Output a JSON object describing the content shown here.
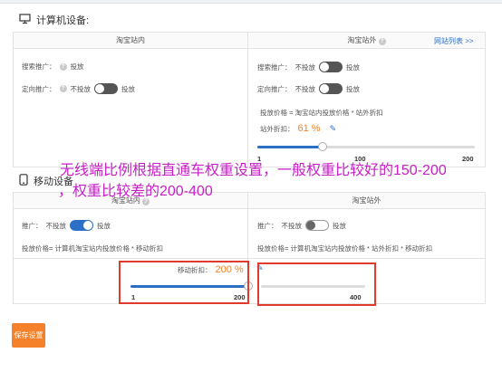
{
  "computer_section": {
    "title": "计算机设备:",
    "inner_header": "淘宝站内",
    "outer_header": "淘宝站外",
    "site_list_link": "网站列表 >>",
    "inner": {
      "search_promo_label": "搜索推广：",
      "search_promo_value": "投放",
      "targeted_promo_label": "定向推广：",
      "no_put": "不投放",
      "put": "投放"
    },
    "outer": {
      "search_promo_label": "搜索推广：",
      "targeted_promo_label": "定向推广：",
      "no_put": "不投放",
      "put": "投放",
      "formula": "投放价格 = 淘宝站内投放价格 * 站外折扣",
      "discount_label": "站外折扣：",
      "discount_value": "61 %",
      "slider_min": "1",
      "slider_mid": "100",
      "slider_max": "200",
      "slider_value_fraction": 0.3
    }
  },
  "mobile_section": {
    "title": "移动设备",
    "inner_header": "淘宝站内",
    "outer_header": "淘宝站外",
    "inner": {
      "promo_label": "推广：",
      "no_put": "不投放",
      "put": "投放",
      "formula": "投放价格= 计算机淘宝站内投放价格 * 移动折扣",
      "discount_label": "移动折扣：",
      "discount_value": "200 %",
      "slider_min": "1",
      "slider_max": "200",
      "slider_value_fraction": 1.0
    },
    "outer": {
      "promo_label": "推广：",
      "no_put": "不投放",
      "put": "投放",
      "formula": "投放价格= 计算机淘宝站内投放价格 * 站外折扣 * 移动折扣",
      "slider_max": "400"
    }
  },
  "annotation": {
    "line1": "无线端比例根据直通车权重设置，一般权重比较好的150-200",
    "line2": "，权重比较差的200-400"
  },
  "save_button": "保存设置",
  "colors": {
    "accent_blue": "#2b6fc6",
    "orange": "#f5822a",
    "annotation_magenta": "#c71fc7",
    "highlight_red": "#e03a2c"
  }
}
